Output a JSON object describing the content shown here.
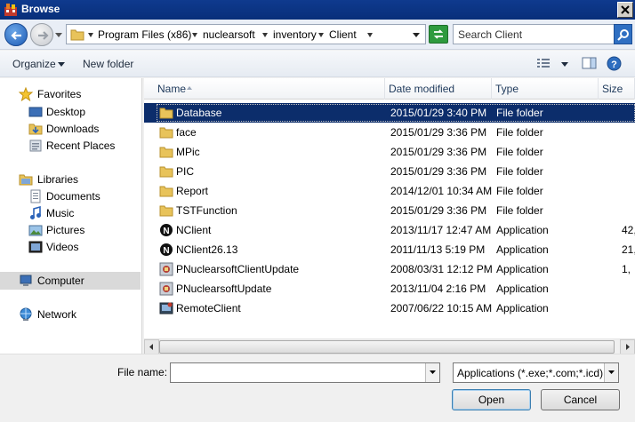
{
  "window": {
    "title": "Browse"
  },
  "address": {
    "crumbs": [
      "Program Files (x86)",
      "nuclearsoft",
      "inventory",
      "Client"
    ],
    "search_placeholder": "Search Client"
  },
  "toolbar": {
    "organize": "Organize",
    "new_folder": "New folder"
  },
  "nav": {
    "favorites": "Favorites",
    "desktop": "Desktop",
    "downloads": "Downloads",
    "recent": "Recent Places",
    "libraries": "Libraries",
    "documents": "Documents",
    "music": "Music",
    "pictures": "Pictures",
    "videos": "Videos",
    "computer": "Computer",
    "network": "Network"
  },
  "columns": {
    "name": "Name",
    "date": "Date modified",
    "type": "Type",
    "size": "Size"
  },
  "files": [
    {
      "name": "Database",
      "date": "2015/01/29 3:40 PM",
      "type": "File folder",
      "size": "",
      "icon": "folder-icon"
    },
    {
      "name": "face",
      "date": "2015/01/29 3:36 PM",
      "type": "File folder",
      "size": "",
      "icon": "folder-icon"
    },
    {
      "name": "MPic",
      "date": "2015/01/29 3:36 PM",
      "type": "File folder",
      "size": "",
      "icon": "folder-icon"
    },
    {
      "name": "PIC",
      "date": "2015/01/29 3:36 PM",
      "type": "File folder",
      "size": "",
      "icon": "folder-icon"
    },
    {
      "name": "Report",
      "date": "2014/12/01 10:34 AM",
      "type": "File folder",
      "size": "",
      "icon": "folder-icon"
    },
    {
      "name": "TSTFunction",
      "date": "2015/01/29 3:36 PM",
      "type": "File folder",
      "size": "",
      "icon": "folder-icon"
    },
    {
      "name": "NClient",
      "date": "2013/11/17 12:47 AM",
      "type": "Application",
      "size": "42,",
      "icon": "app-n-icon"
    },
    {
      "name": "NClient26.13",
      "date": "2011/11/13 5:19 PM",
      "type": "Application",
      "size": "21,",
      "icon": "app-n-icon"
    },
    {
      "name": "PNuclearsoftClientUpdate",
      "date": "2008/03/31 12:12 PM",
      "type": "Application",
      "size": "1,",
      "icon": "update-app-icon"
    },
    {
      "name": "PNuclearsoftUpdate",
      "date": "2013/11/04 2:16 PM",
      "type": "Application",
      "size": "",
      "icon": "update-app-icon"
    },
    {
      "name": "RemoteClient",
      "date": "2007/06/22 10:15 AM",
      "type": "Application",
      "size": "",
      "icon": "remote-app-icon"
    }
  ],
  "footer": {
    "file_name_label": "File name:",
    "file_name_value": "",
    "file_type": "Applications (*.exe;*.com;*.icd)",
    "open": "Open",
    "cancel": "Cancel"
  }
}
